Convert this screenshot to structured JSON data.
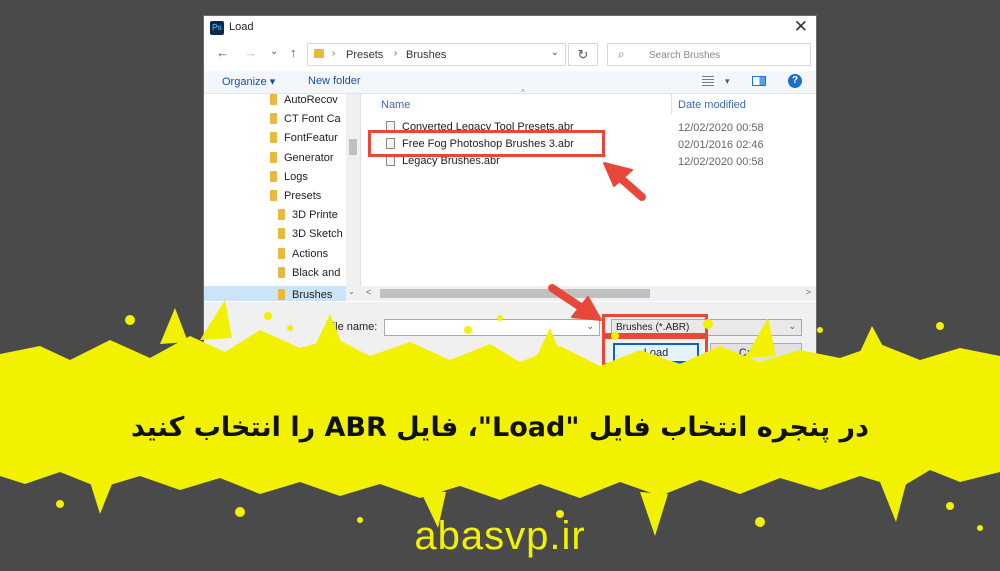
{
  "dialog": {
    "title": "Load",
    "app_icon_label": "Ps",
    "close_glyph": "✕",
    "nav": {
      "back": "←",
      "forward": "→",
      "dropdown": "⌄",
      "up": "↑"
    },
    "address": {
      "crumbs": [
        "Presets",
        "Brushes"
      ],
      "separator": "›",
      "dropdown": "⌄"
    },
    "refresh_glyph": "↻",
    "search": {
      "icon": "⌕",
      "placeholder": "Search Brushes"
    },
    "toolbar": {
      "organize": "Organize ▾",
      "new_folder": "New folder",
      "view_dropdown": "▾",
      "help": "?"
    },
    "nav_items": [
      {
        "label": "AutoRecov"
      },
      {
        "label": "CT Font Ca"
      },
      {
        "label": "FontFeatur"
      },
      {
        "label": "Generator"
      },
      {
        "label": "Logs"
      },
      {
        "label": "Presets"
      },
      {
        "label": "3D Printe"
      },
      {
        "label": "3D Sketch"
      },
      {
        "label": "Actions"
      },
      {
        "label": "Black and"
      },
      {
        "label": "Brushes",
        "selected": true
      }
    ],
    "columns": {
      "name": "Name",
      "date_modified": "Date modified",
      "sort_caret": "^"
    },
    "files": [
      {
        "name": "Converted Legacy Tool Presets.abr",
        "date": "12/02/2020 00:58"
      },
      {
        "name": "Free Fog Photoshop Brushes 3.abr",
        "date": "02/01/2016 02:46"
      },
      {
        "name": "Legacy Brushes.abr",
        "date": "12/02/2020 00:58"
      }
    ],
    "scroll": {
      "left": "<",
      "right": ">",
      "down": "⌄"
    },
    "file_name_label": "File name:",
    "file_name_value": "",
    "file_type": "Brushes (*.ABR)",
    "field_dropdown": "⌄",
    "load_button": "Load",
    "cancel_button": "Cancel"
  },
  "caption": "در پنجره انتخاب فایل \"Load\"، فایل ABR را انتخاب کنید",
  "site": "abasvp.ir",
  "colors": {
    "background": "#4a4a4a",
    "splash": "#f2f200",
    "highlight": "#e8483a",
    "accent_blue": "#0a64c8"
  }
}
